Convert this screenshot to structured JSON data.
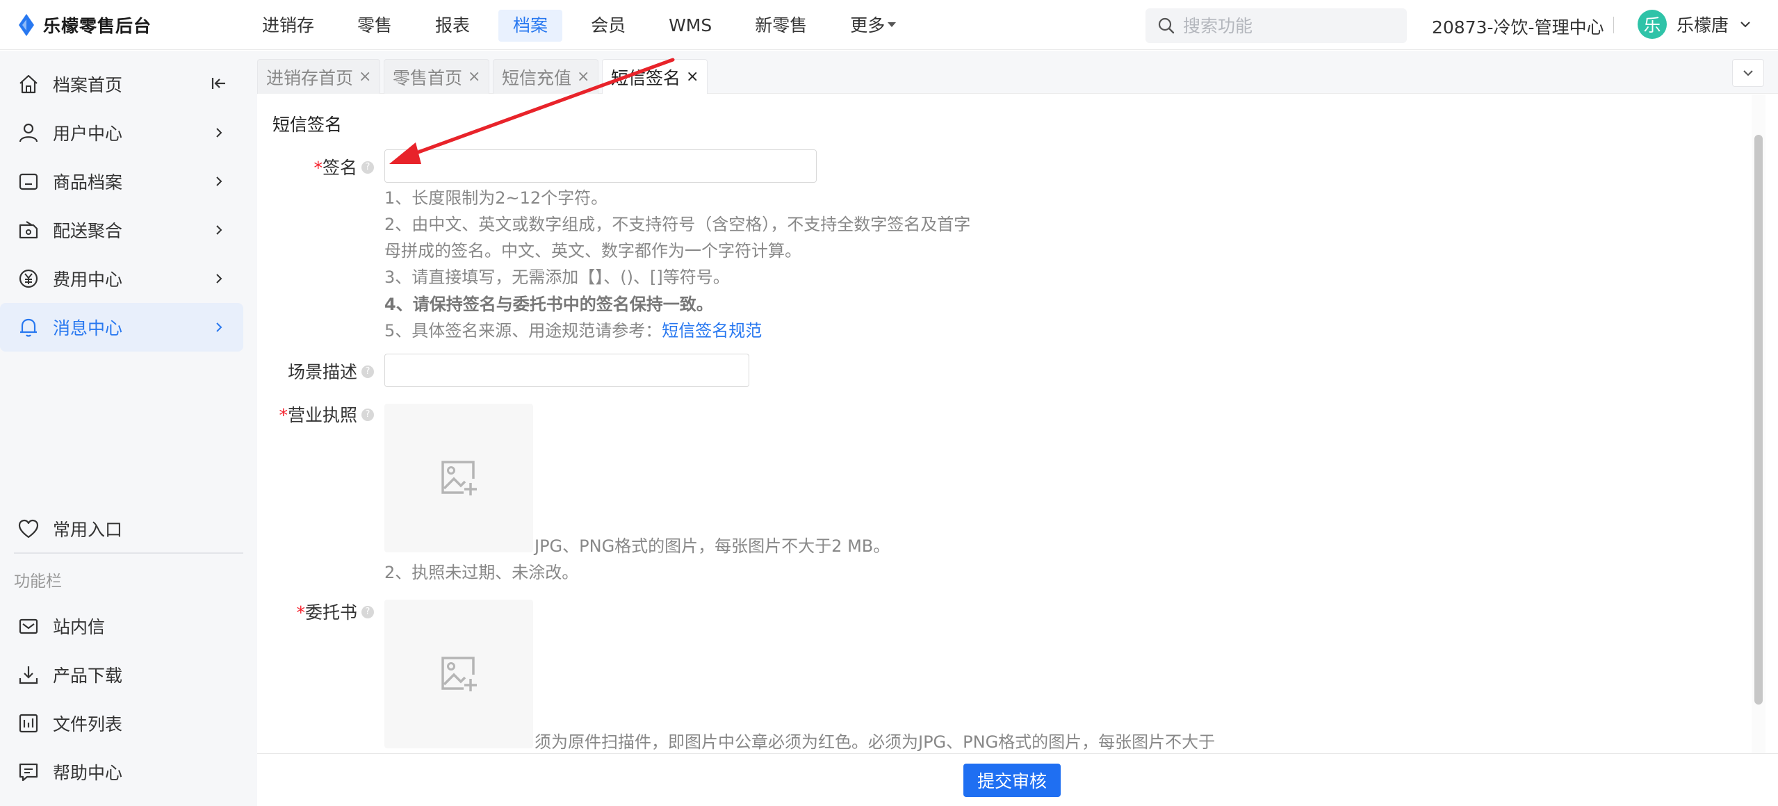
{
  "app": {
    "name": "乐檬零售后台"
  },
  "nav": {
    "items": [
      {
        "label": "进销存"
      },
      {
        "label": "零售"
      },
      {
        "label": "报表"
      },
      {
        "label": "档案"
      },
      {
        "label": "会员"
      },
      {
        "label": "WMS"
      },
      {
        "label": "新零售"
      },
      {
        "label": "更多"
      }
    ],
    "active": "档案"
  },
  "search": {
    "placeholder": "搜索功能"
  },
  "store": {
    "name": "20873-冷饮-管理中心"
  },
  "user": {
    "avatar_char": "乐",
    "name": "乐檬唐"
  },
  "sidebar": {
    "items": [
      {
        "label": "档案首页",
        "icon": "home-icon"
      },
      {
        "label": "用户中心",
        "icon": "user-icon"
      },
      {
        "label": "商品档案",
        "icon": "box-icon"
      },
      {
        "label": "配送聚合",
        "icon": "delivery-icon"
      },
      {
        "label": "费用中心",
        "icon": "yen-icon"
      },
      {
        "label": "消息中心",
        "icon": "bell-icon",
        "active": true
      },
      {
        "label": "常用入口",
        "icon": "heart-icon"
      }
    ],
    "section_label": "功能栏",
    "tools": [
      {
        "label": "站内信",
        "icon": "mail-icon"
      },
      {
        "label": "产品下载",
        "icon": "download-icon"
      },
      {
        "label": "文件列表",
        "icon": "file-list-icon"
      },
      {
        "label": "帮助中心",
        "icon": "help-chat-icon"
      }
    ]
  },
  "tabs": [
    {
      "label": "进销存首页",
      "close": "×"
    },
    {
      "label": "零售首页",
      "close": "×"
    },
    {
      "label": "短信充值",
      "close": "×"
    },
    {
      "label": "短信签名",
      "close": "×",
      "active": true
    }
  ],
  "form": {
    "title": "短信签名",
    "required_mark": "*",
    "help_mark": "?",
    "signature": {
      "label": "签名",
      "value": "",
      "hints": [
        "1、长度限制为2~12个字符。",
        "2、由中文、英文或数字组成，不支持符号（含空格），不支持全数字签名及首字",
        "母拼成的签名。中文、英文、数字都作为一个字符计算。",
        "3、请直接填写，无需添加【】、()、[]等符号。",
        "4、请保持签名与委托书中的签名保持一致。",
        "5、具体签名来源、用途规范请参考："
      ],
      "link_text": "短信签名规范"
    },
    "scene": {
      "label": "场景描述",
      "value": ""
    },
    "license": {
      "label": "营业执照",
      "hints": [
        "JPG、PNG格式的图片，每张图片不大于2 MB。",
        "2、执照未过期、未涂改。"
      ]
    },
    "authorization": {
      "label": "委托书",
      "hints": [
        "须为原件扫描件，即图片中公章必须为红色。必须为JPG、PNG格式的图片，每张图片不大于"
      ]
    },
    "submit_label": "提交审核"
  },
  "colors": {
    "accent": "#1f6ff2",
    "active_nav_bg": "#e9f1fe",
    "required": "#f5222d",
    "annotation_arrow": "#e8232a"
  }
}
